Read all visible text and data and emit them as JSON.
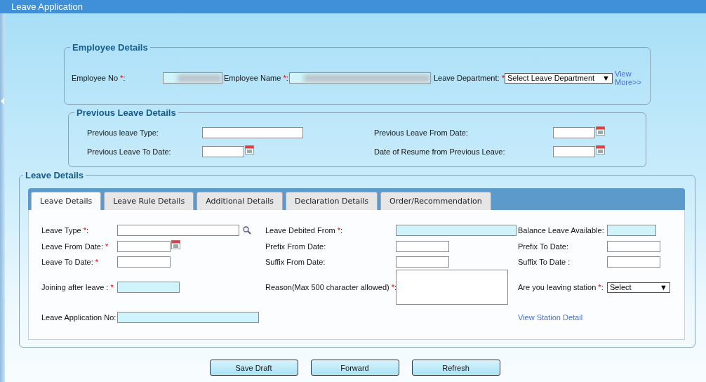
{
  "window": {
    "title": "Leave Application"
  },
  "employee": {
    "legend": "Employee Details",
    "fields": [
      {
        "kind": "text",
        "label": "Employee No",
        "required": "*",
        "tail": ":",
        "locked": true,
        "redacted": true
      },
      {
        "kind": "text",
        "label": "Employee Name",
        "required": "*",
        "tail": ":",
        "locked": true,
        "redacted": true
      },
      {
        "kind": "select",
        "label": "Leave Department:",
        "required": "*",
        "value": "Select Leave Department",
        "arrow": "▼"
      }
    ],
    "link": "View More>>"
  },
  "previous": {
    "legend": "Previous Leave Details",
    "fields": [
      {
        "kind": "text",
        "label": "Previous leave Type:",
        "locked": false
      },
      {
        "kind": "date",
        "label": "Previous Leave From Date:",
        "locked": false
      },
      {
        "kind": "date",
        "label": "Previous Leave To Date:",
        "locked": false
      },
      {
        "kind": "date",
        "label": "Date of Resume from Previous Leave:",
        "locked": false
      }
    ]
  },
  "leave": {
    "legend": "Leave Details",
    "tabs": [
      {
        "label": "Leave Details",
        "selected": true
      },
      {
        "label": "Leave Rule Details",
        "selected": false
      },
      {
        "label": "Additional Details",
        "selected": false
      },
      {
        "label": "Declaration Details",
        "selected": false
      },
      {
        "label": "Order/Recommendation",
        "selected": false
      }
    ],
    "rows": [
      [
        {
          "kind": "lookup",
          "label": "Leave Type",
          "required": "*",
          "tail": ":",
          "locked": false
        },
        {
          "kind": "text",
          "label": "Leave Debited From",
          "required": "*",
          "tail": ":",
          "locked": true
        },
        {
          "kind": "text",
          "label": "Balance Leave Available:",
          "locked": true
        }
      ],
      [
        {
          "kind": "date",
          "label": "Leave From Date:",
          "required": "*",
          "locked": false
        },
        {
          "kind": "text",
          "label": "Prefix From Date:",
          "locked": false
        },
        {
          "kind": "text",
          "label": "Prefix To Date:",
          "locked": false
        }
      ],
      [
        {
          "kind": "text",
          "label": "Leave To Date:",
          "required": "*",
          "locked": false
        },
        {
          "kind": "text",
          "label": "Suffix From Date:",
          "locked": false
        },
        {
          "kind": "text",
          "label": "Suffix To Date :",
          "locked": false
        }
      ],
      [
        {
          "kind": "text",
          "label": "Joining after leave :",
          "required": "*",
          "locked": true
        },
        {
          "kind": "textarea",
          "label": "Reason(Max 500 character allowed)",
          "required": "*",
          "tail": ":",
          "locked": false
        },
        {
          "kind": "select",
          "label": "Are you leaving station",
          "required": "*",
          "tail": ":",
          "value": "Select",
          "arrow": "▼"
        }
      ],
      [
        {
          "kind": "text",
          "label": "Leave Application No:",
          "locked": true
        },
        "",
        {
          "kind": "link",
          "text": "View Station Detail"
        }
      ]
    ]
  },
  "buttons": [
    "Save Draft",
    "Forward",
    "Refresh"
  ]
}
